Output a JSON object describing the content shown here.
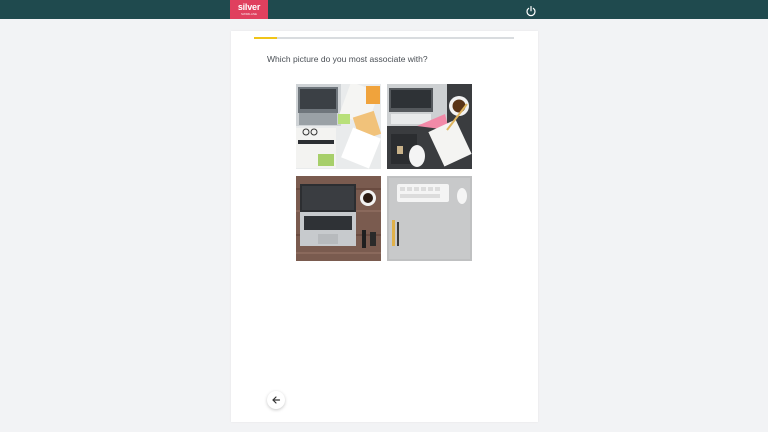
{
  "header": {
    "brand_name": "silver",
    "brand_tagline": "SWIMLANE",
    "brand_color": "#e0405e",
    "bar_color": "#1f4a4e",
    "power_icon": "power-icon"
  },
  "survey": {
    "progress_fraction": 0.09,
    "progress_color": "#f0c419",
    "question": "Which picture do you most associate with?",
    "options": [
      {
        "image": "workspace-papers-laptop-photo"
      },
      {
        "image": "workspace-coffee-tablet-photo"
      },
      {
        "image": "workspace-wood-desk-laptop-photo"
      },
      {
        "image": "workspace-grey-minimal-photo"
      }
    ],
    "back_icon": "arrow-left-icon"
  }
}
